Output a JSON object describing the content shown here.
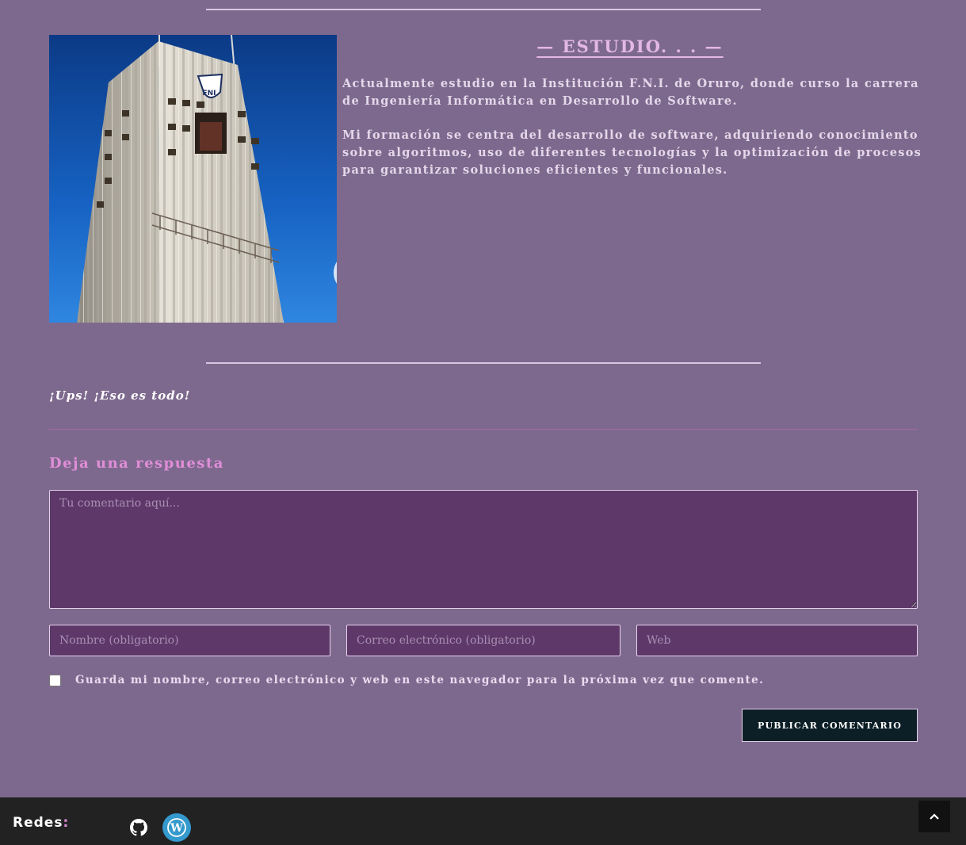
{
  "study": {
    "title": "— ESTUDIO. . . —",
    "paragraphs": [
      "Actualmente estudio en la Institución F.N.I. de Oruro, donde curso la carrera de Ingeniería Informática en Desarrollo de Software.",
      "Mi formación se centra del desarrollo de software, adquiriendo conocimiento sobre algoritmos, uso de diferentes tecnologías y la optimización de procesos para garantizar soluciones eficientes y funcionales."
    ],
    "image_logo_text": "FNI"
  },
  "end_note": "¡Ups! ¡Eso es todo!",
  "comment_form": {
    "title": "Deja una respuesta",
    "comment_placeholder": "Tu comentario aquí...",
    "name_placeholder": "Nombre (obligatorio)",
    "email_placeholder": "Correo electrónico (obligatorio)",
    "web_placeholder": "Web",
    "save_label": "Guarda mi nombre, correo electrónico y web en este navegador para la próxima vez que comente.",
    "save_checked": false,
    "submit_label": "PUBLICAR COMENTARIO"
  },
  "footer": {
    "label": "Redes",
    "colon": ":",
    "social": [
      {
        "icon": "github-icon"
      },
      {
        "icon": "wordpress-icon"
      }
    ]
  },
  "colors": {
    "background": "#7e698e",
    "accent_pink": "#e08ed8",
    "field_bg": "#5e3869",
    "button_bg": "#0c1e26",
    "footer_bg": "#222222",
    "wordpress_blue": "#3499cd"
  }
}
